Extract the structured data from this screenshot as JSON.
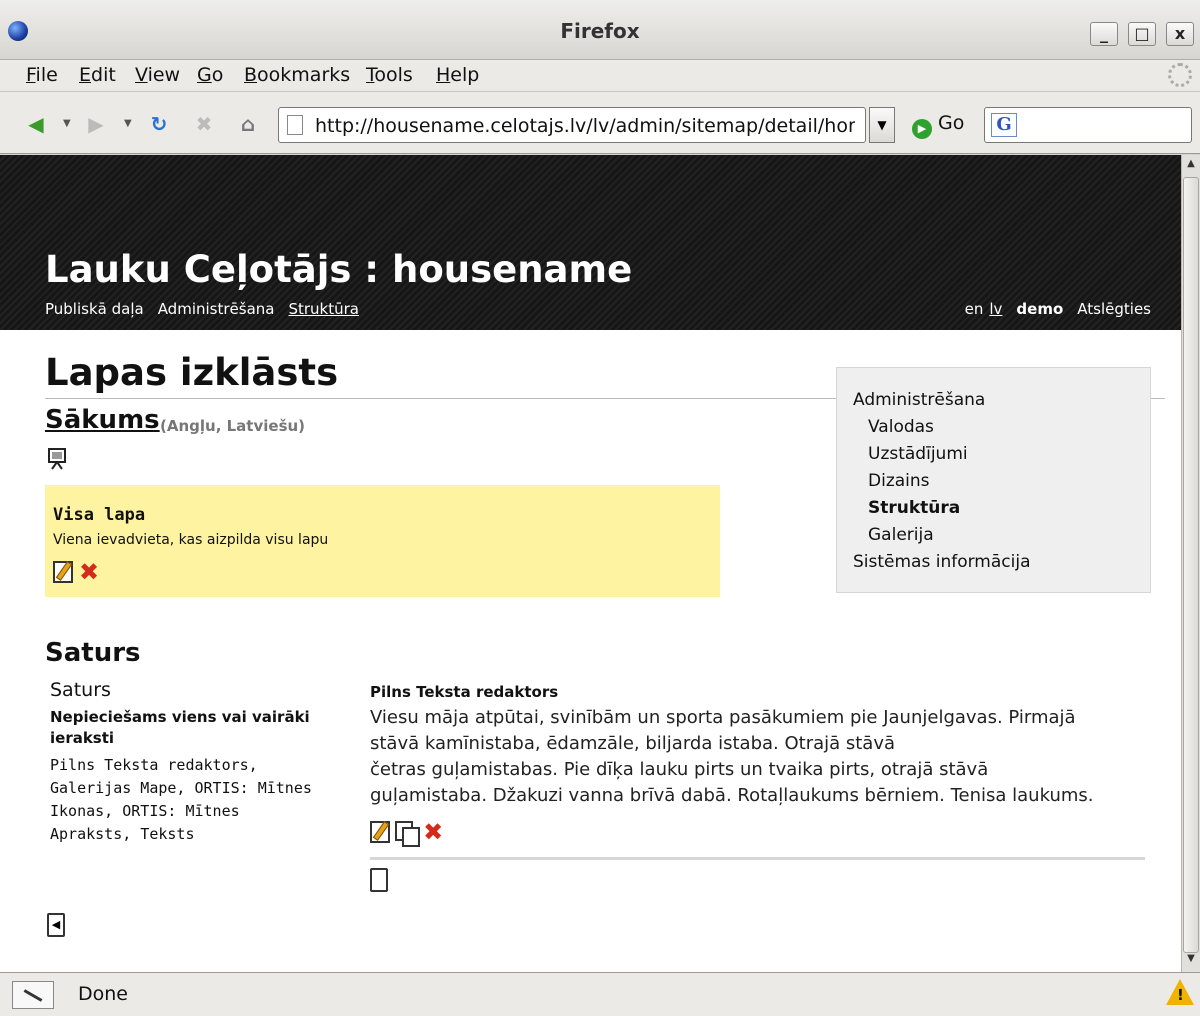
{
  "window": {
    "title": "Firefox",
    "buttons": {
      "minimize": "_",
      "maximize": "□",
      "close": "x"
    }
  },
  "menubar": {
    "items": [
      {
        "first": "F",
        "rest": "ile"
      },
      {
        "first": "E",
        "rest": "dit"
      },
      {
        "first": "V",
        "rest": "iew"
      },
      {
        "first": "G",
        "rest": "o"
      },
      {
        "first": "B",
        "rest": "ookmarks"
      },
      {
        "first": "T",
        "rest": "ools"
      },
      {
        "first": "H",
        "rest": "elp"
      }
    ]
  },
  "toolbar": {
    "url": "http://housename.celotajs.lv/lv/admin/sitemap/detail/home",
    "go_label": "Go",
    "search_engine_glyph": "G"
  },
  "site": {
    "title": "Lauku Ceļotājs : housename",
    "nav": [
      "Publiskā daļa",
      "Administrēšana",
      "Struktūra"
    ],
    "lang_en": "en",
    "lang_lv": "lv",
    "user": "demo",
    "logout": "Atslēgties"
  },
  "page": {
    "title": "Lapas izklāsts",
    "section_link": "Sākums",
    "section_langs": "(Angļu, Latviešu)",
    "layout_block": {
      "title": "Visa lapa",
      "description": "Viena ievadvieta, kas aizpilda visu lapu"
    },
    "content_heading": "Saturs",
    "placeholder": {
      "title": "Saturs",
      "requirement": "Nepieciešams viens vai vairāki ieraksti",
      "allowed_types": "Pilns Teksta redaktors, Galerijas Mape, ORTIS: Mītnes Ikonas, ORTIS: Mītnes Apraksts, Teksts"
    },
    "entry": {
      "type": "Pilns Teksta redaktors",
      "text_lines": [
        "Viesu māja atpūtai, svinībām un sporta pasākumiem pie Jaunjelgavas. Pirmajā",
        "stāvā kamīnistaba, ēdamzāle, biljarda istaba. Otrajā stāvā",
        "četras guļamistabas. Pie dīķa lauku pirts un tvaika pirts, otrajā stāvā",
        "guļamistaba. Džakuzi vanna brīvā dabā. Rotaļlaukums bērniem. Tenisa laukums."
      ]
    }
  },
  "side_menu": {
    "items": [
      {
        "label": "Administrēšana",
        "level": 0,
        "active": false
      },
      {
        "label": "Valodas",
        "level": 1,
        "active": false
      },
      {
        "label": "Uzstādījumi",
        "level": 1,
        "active": false
      },
      {
        "label": "Dizains",
        "level": 1,
        "active": false
      },
      {
        "label": "Struktūra",
        "level": 1,
        "active": true
      },
      {
        "label": "Galerija",
        "level": 1,
        "active": false
      },
      {
        "label": "Sistēmas informācija",
        "level": 0,
        "active": false
      }
    ]
  },
  "status": {
    "text": "Done"
  }
}
